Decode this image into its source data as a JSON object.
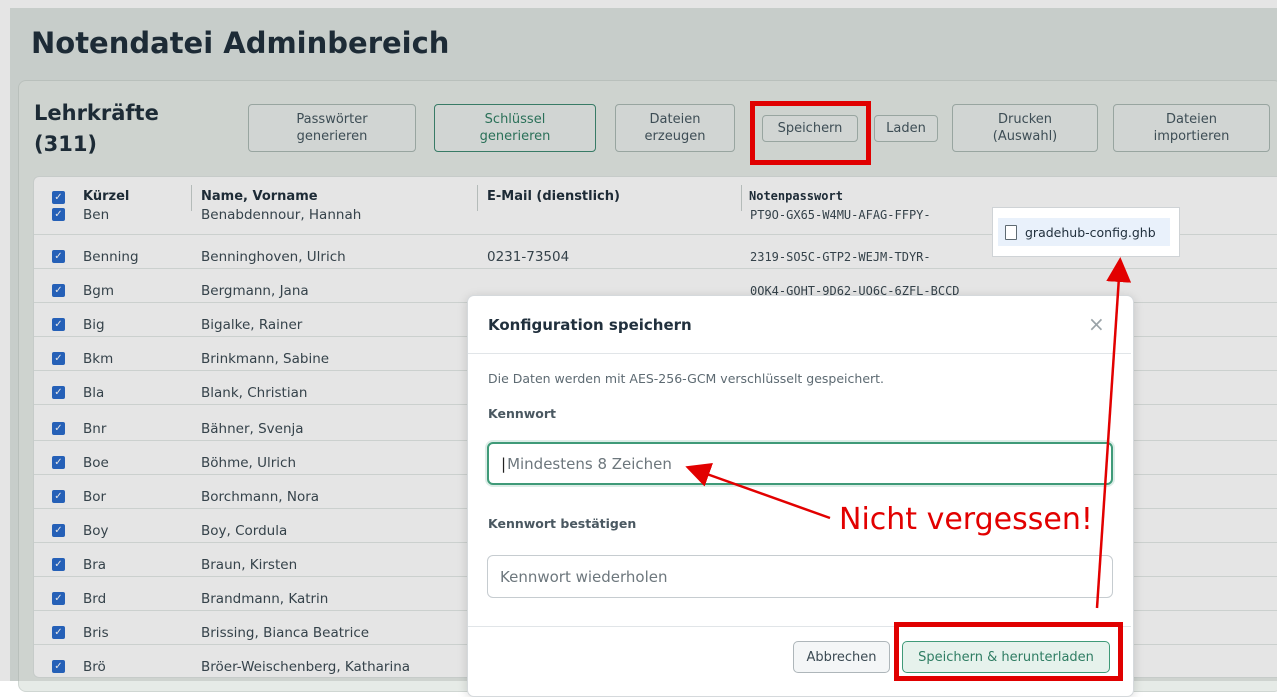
{
  "page_title": "Notendatei Adminbereich",
  "section": {
    "title": "Lehrkräfte",
    "count": "(311)"
  },
  "toolbar": {
    "passwords": "Passwörter\ngenerieren",
    "keys": "Schlüssel\ngenerieren",
    "files": "Dateien\nerzeugen",
    "save": "Speichern",
    "load": "Laden",
    "print": "Drucken\n(Auswahl)",
    "import": "Dateien\nimportieren"
  },
  "table": {
    "headers": {
      "code": "Kürzel",
      "name": "Name, Vorname",
      "email": "E-Mail (dienstlich)",
      "password": "Notenpasswort"
    },
    "rows": [
      {
        "code": "Ben",
        "name": "Benabdennour, Hannah",
        "email": "",
        "password": "PT9O-GX65-W4MU-AFAG-FFPY-"
      },
      {
        "code": "Benning",
        "name": "Benninghoven, Ulrich",
        "email": "0231-73504",
        "password": "2319-SO5C-GTP2-WEJM-TDYR-"
      },
      {
        "code": "Bgm",
        "name": "Bergmann, Jana",
        "email": "",
        "password": "0OK4-GOHT-9D62-UO6C-6ZFL-BCCD"
      },
      {
        "code": "Big",
        "name": "Bigalke, Rainer",
        "email": "",
        "password": ""
      },
      {
        "code": "Bkm",
        "name": "Brinkmann, Sabine",
        "email": "",
        "password": ""
      },
      {
        "code": "Bla",
        "name": "Blank, Christian",
        "email": "",
        "password": ""
      },
      {
        "code": "Bnr",
        "name": "Bähner, Svenja",
        "email": "",
        "password": ""
      },
      {
        "code": "Boe",
        "name": "Böhme, Ulrich",
        "email": "",
        "password": ""
      },
      {
        "code": "Bor",
        "name": "Borchmann, Nora",
        "email": "",
        "password": ""
      },
      {
        "code": "Boy",
        "name": "Boy, Cordula",
        "email": "",
        "password": ""
      },
      {
        "code": "Bra",
        "name": "Braun, Kirsten",
        "email": "",
        "password": ""
      },
      {
        "code": "Brd",
        "name": "Brandmann, Katrin",
        "email": "",
        "password": ""
      },
      {
        "code": "Bris",
        "name": "Brissing, Bianca Beatrice",
        "email": "",
        "password": ""
      },
      {
        "code": "Brö",
        "name": "Bröer-Weischenberg, Katharina",
        "email": "",
        "password": ""
      }
    ]
  },
  "modal": {
    "title": "Konfiguration speichern",
    "description": "Die Daten werden mit AES-256-GCM verschlüsselt gespeichert.",
    "password_label": "Kennwort",
    "password_placeholder": "Mindestens 8 Zeichen",
    "confirm_label": "Kennwort bestätigen",
    "confirm_placeholder": "Kennwort wiederholen",
    "cancel": "Abbrechen",
    "submit": "Speichern & herunterladen"
  },
  "download": {
    "filename": "gradehub-config.ghb"
  },
  "annotation": {
    "text": "Nicht vergessen!",
    "color": "#e20000"
  },
  "colors": {
    "accent_green": "#3f9a78",
    "checkbox_blue": "#2a6bcc",
    "highlight_red": "#e00000"
  }
}
